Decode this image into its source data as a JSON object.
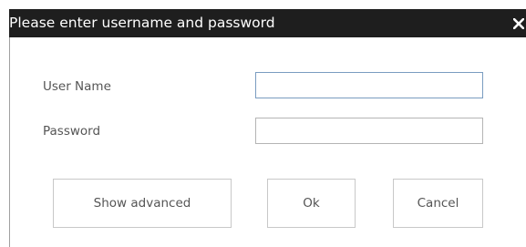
{
  "dialog": {
    "title": "Please enter username and password",
    "close_icon": "close-icon"
  },
  "form": {
    "username_label": "User Name",
    "username_value": "",
    "password_label": "Password",
    "password_value": ""
  },
  "buttons": {
    "advanced_label": "Show advanced",
    "ok_label": "Ok",
    "cancel_label": "Cancel"
  },
  "colors": {
    "titlebar": "#1e1e1e",
    "title_text": "#ffffff",
    "focused_border": "#7a9cc0"
  }
}
